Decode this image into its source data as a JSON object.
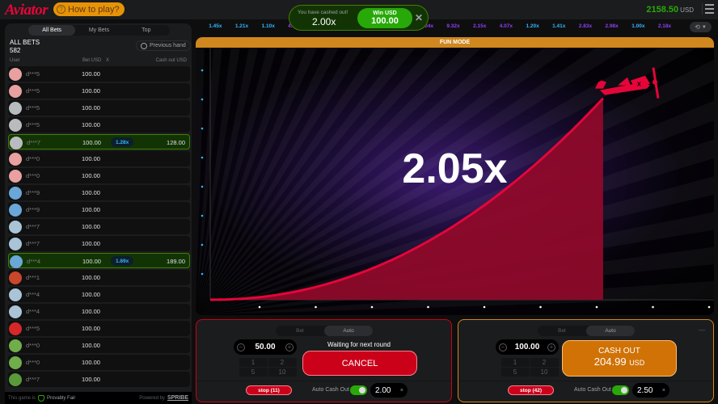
{
  "header": {
    "logo": "Aviator",
    "how_to_play": "How to play?",
    "balance": "2158.50",
    "currency": "USD",
    "menu_icon": "hamburger-menu-icon"
  },
  "bets_panel": {
    "tabs": [
      {
        "label": "All Bets",
        "active": true
      },
      {
        "label": "My Bets",
        "active": false
      },
      {
        "label": "Top",
        "active": false
      }
    ],
    "title": "ALL BETS",
    "count": "582",
    "previous_hand": "Previous hand",
    "columns": {
      "user": "User",
      "bet": "Bet USD",
      "x": "X",
      "cashout": "Cash out USD"
    },
    "rows": [
      {
        "user": "d***5",
        "bet": "100.00",
        "mult": "",
        "cashout": "",
        "avatar": "#e8a0a0",
        "win": false
      },
      {
        "user": "d***5",
        "bet": "100.00",
        "mult": "",
        "cashout": "",
        "avatar": "#e8a0a0",
        "win": false
      },
      {
        "user": "d***5",
        "bet": "100.00",
        "mult": "",
        "cashout": "",
        "avatar": "#b8bcbf",
        "win": false
      },
      {
        "user": "d***5",
        "bet": "100.00",
        "mult": "",
        "cashout": "",
        "avatar": "#b8bcbf",
        "win": false
      },
      {
        "user": "d***7",
        "bet": "100.00",
        "mult": "1.28x",
        "cashout": "128.00",
        "avatar": "#b8bcbf",
        "win": true
      },
      {
        "user": "d***0",
        "bet": "100.00",
        "mult": "",
        "cashout": "",
        "avatar": "#e8a0a0",
        "win": false
      },
      {
        "user": "d***0",
        "bet": "100.00",
        "mult": "",
        "cashout": "",
        "avatar": "#e8a0a0",
        "win": false
      },
      {
        "user": "d***9",
        "bet": "100.00",
        "mult": "",
        "cashout": "",
        "avatar": "#6aa7d8",
        "win": false
      },
      {
        "user": "d***9",
        "bet": "100.00",
        "mult": "",
        "cashout": "",
        "avatar": "#6aa7d8",
        "win": false
      },
      {
        "user": "d***7",
        "bet": "100.00",
        "mult": "",
        "cashout": "",
        "avatar": "#a9c4d6",
        "win": false
      },
      {
        "user": "d***7",
        "bet": "100.00",
        "mult": "",
        "cashout": "",
        "avatar": "#a9c4d6",
        "win": false
      },
      {
        "user": "d***4",
        "bet": "100.00",
        "mult": "1.89x",
        "cashout": "189.00",
        "avatar": "#6aa7d8",
        "win": true
      },
      {
        "user": "d***1",
        "bet": "100.00",
        "mult": "",
        "cashout": "",
        "avatar": "#c9472a",
        "win": false
      },
      {
        "user": "d***4",
        "bet": "100.00",
        "mult": "",
        "cashout": "",
        "avatar": "#a9c4d6",
        "win": false
      },
      {
        "user": "d***4",
        "bet": "100.00",
        "mult": "",
        "cashout": "",
        "avatar": "#a9c4d6",
        "win": false
      },
      {
        "user": "d***5",
        "bet": "100.00",
        "mult": "",
        "cashout": "",
        "avatar": "#d62828",
        "win": false
      },
      {
        "user": "d***0",
        "bet": "100.00",
        "mult": "",
        "cashout": "",
        "avatar": "#6fae4a",
        "win": false
      },
      {
        "user": "d***0",
        "bet": "100.00",
        "mult": "",
        "cashout": "",
        "avatar": "#6fae4a",
        "win": false
      },
      {
        "user": "d***7",
        "bet": "100.00",
        "mult": "",
        "cashout": "",
        "avatar": "#5a9a3a",
        "win": false
      }
    ],
    "footer": {
      "prefix": "This game is",
      "provably_fair": "Provably Fair",
      "powered_by": "Powered by",
      "brand": "SPRIBE"
    }
  },
  "history": [
    {
      "value": "1.45x",
      "color": "#34b4ff"
    },
    {
      "value": "1.21x",
      "color": "#34b4ff"
    },
    {
      "value": "1.10x",
      "color": "#34b4ff"
    },
    {
      "value": "4.8?x",
      "color": "#913ef8"
    },
    {
      "value": "",
      "color": "#34b4ff"
    },
    {
      "value": "",
      "color": "#34b4ff"
    },
    {
      "value": "",
      "color": "#34b4ff"
    },
    {
      "value": "",
      "color": "#34b4ff"
    },
    {
      "value": "?.04x",
      "color": "#913ef8"
    },
    {
      "value": "9.32x",
      "color": "#913ef8"
    },
    {
      "value": "2.15x",
      "color": "#913ef8"
    },
    {
      "value": "4.07x",
      "color": "#913ef8"
    },
    {
      "value": "1.20x",
      "color": "#34b4ff"
    },
    {
      "value": "1.41x",
      "color": "#34b4ff"
    },
    {
      "value": "2.83x",
      "color": "#913ef8"
    },
    {
      "value": "2.98x",
      "color": "#913ef8"
    },
    {
      "value": "1.00x",
      "color": "#34b4ff"
    },
    {
      "value": "2.18x",
      "color": "#913ef8"
    }
  ],
  "toast": {
    "message": "You have cashed out!",
    "multiplier": "2.00x",
    "win_label": "Win USD",
    "win_amount": "100.00"
  },
  "game": {
    "mode_banner": "FUN MODE",
    "multiplier": "2.05x",
    "curve_progress": 0.78
  },
  "panel1": {
    "tabs": [
      {
        "label": "Bet",
        "active": false
      },
      {
        "label": "Auto",
        "active": true
      }
    ],
    "amount": "50.00",
    "quick": [
      "1",
      "2",
      "5",
      "10"
    ],
    "status": "Waiting for next round",
    "action": "CANCEL",
    "stop": "stop (11)",
    "auto_cashout_label": "Auto Cash Out",
    "auto_cashout_on": true,
    "auto_cashout_value": "2.00"
  },
  "panel2": {
    "tabs": [
      {
        "label": "Bet",
        "active": false
      },
      {
        "label": "Auto",
        "active": true
      }
    ],
    "amount": "100.00",
    "quick": [
      "1",
      "2",
      "5",
      "10"
    ],
    "action": "CASH OUT",
    "cashout_amount": "204.99",
    "cashout_currency": "USD",
    "stop": "stop (42)",
    "auto_cashout_label": "Auto Cash Out",
    "auto_cashout_on": true,
    "auto_cashout_value": "2.50"
  }
}
